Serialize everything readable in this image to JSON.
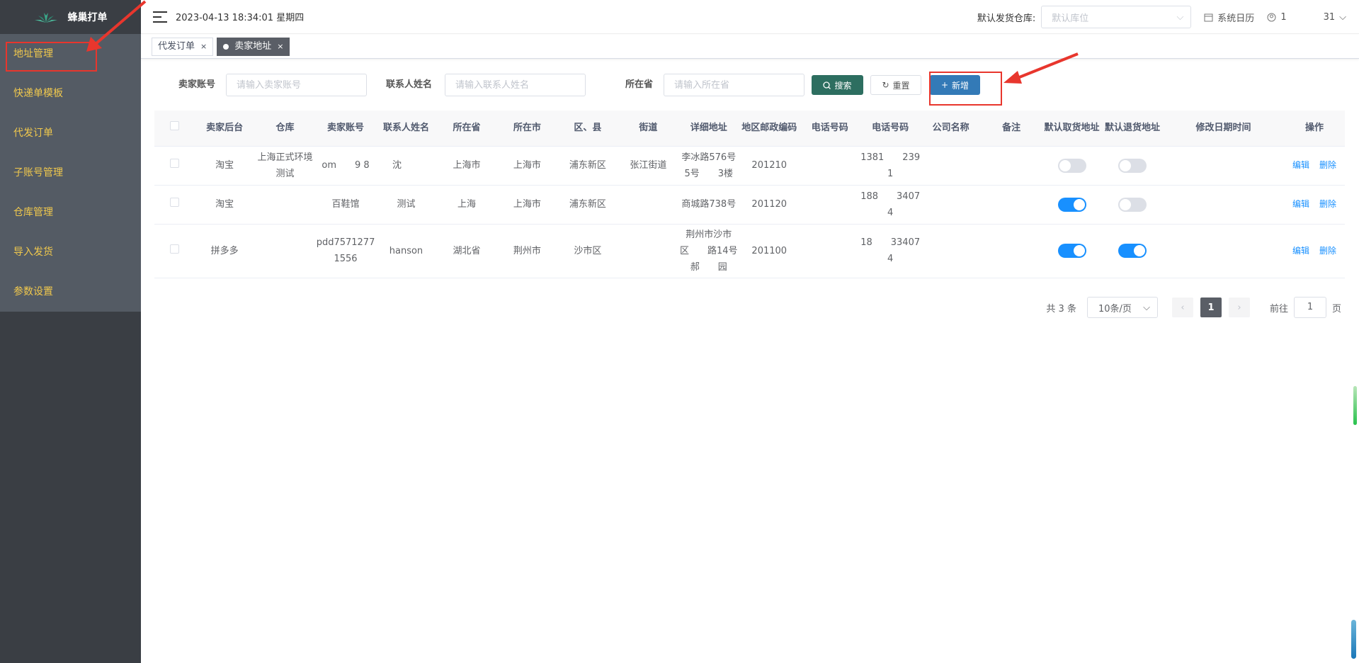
{
  "app": {
    "title": "蜂巢打单"
  },
  "sidebar": {
    "items": [
      {
        "label": "地址管理"
      },
      {
        "label": "快递单模板"
      },
      {
        "label": "代发订单"
      },
      {
        "label": "子账号管理"
      },
      {
        "label": "仓库管理"
      },
      {
        "label": "导入发货"
      },
      {
        "label": "参数设置"
      }
    ]
  },
  "header": {
    "datetime": "2023-04-13 18:34:01 星期四",
    "warehouse_label": "默认发货仓库:",
    "warehouse_placeholder": "默认库位",
    "calendar_label": "系统日历",
    "user_label": "1    31"
  },
  "tabs": [
    {
      "label": "代发订单"
    },
    {
      "label": "卖家地址"
    }
  ],
  "search": {
    "seller_account_label": "卖家账号",
    "seller_account_placeholder": "请输入卖家账号",
    "contact_name_label": "联系人姓名",
    "contact_name_placeholder": "请输入联系人姓名",
    "province_label": "所在省",
    "province_placeholder": "请输入所在省",
    "search_button": "搜索",
    "reset_button": "重置",
    "add_button": "新增"
  },
  "table": {
    "columns": [
      "卖家后台",
      "仓库",
      "卖家账号",
      "联系人姓名",
      "所在省",
      "所在市",
      "区、县",
      "街道",
      "详细地址",
      "地区邮政编码",
      "电话号码",
      "电话号码",
      "公司名称",
      "备注",
      "默认取货地址",
      "默认退货地址",
      "修改日期时间",
      "操作"
    ],
    "rows": [
      {
        "platform": "淘宝",
        "warehouse": "上海正式环境测试",
        "account": "om  9 8",
        "contact": "沈  ",
        "province": "上海市",
        "city": "上海市",
        "district": "浦东新区",
        "street": "张江街道",
        "address": "李冰路576号5号  3楼",
        "zip": "201210",
        "phone1": "",
        "phone2": "1381  239 1",
        "company": "",
        "remark": "",
        "default_pickup": false,
        "default_return": false,
        "modified": ""
      },
      {
        "platform": "淘宝",
        "warehouse": "",
        "account": "百鞋馆",
        "contact": "测试",
        "province": "上海",
        "city": "上海市",
        "district": "浦东新区",
        "street": "",
        "address": "商城路738号",
        "zip": "201120",
        "phone1": "",
        "phone2": "188  3407 4",
        "company": "",
        "remark": "",
        "default_pickup": true,
        "default_return": false,
        "modified": ""
      },
      {
        "platform": "拼多多",
        "warehouse": "",
        "account": "pdd75712771556",
        "contact": "hanson",
        "province": "湖北省",
        "city": "荆州市",
        "district": "沙市区",
        "street": "",
        "address": "荆州市沙市区  路14号郝  园",
        "zip": "201100",
        "phone1": "",
        "phone2": "18  33407 4",
        "company": "",
        "remark": "",
        "default_pickup": true,
        "default_return": true,
        "modified": ""
      }
    ],
    "edit_label": "编辑",
    "delete_label": "删除"
  },
  "pagination": {
    "total": "共 3 条",
    "page_size": "10条/页",
    "current_page": "1",
    "goto_label": "前往",
    "goto_value": "1",
    "page_suffix": "页"
  },
  "colors": {
    "sidebar_bg": "#545b64",
    "sidebar_text": "#f0c84d",
    "search_button": "#2d6e60",
    "add_button": "#337ab7",
    "switch_on": "#1890ff",
    "annotation": "#e8362d"
  }
}
